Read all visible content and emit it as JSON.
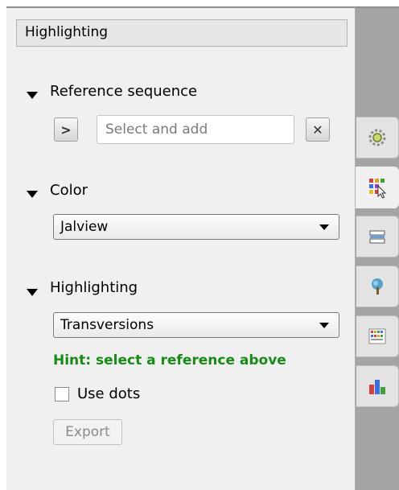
{
  "header": {
    "title": "Highlighting"
  },
  "reference": {
    "title": "Reference sequence",
    "placeholder": "Select and add",
    "expand_glyph": ">",
    "clear_glyph": "✕"
  },
  "color": {
    "title": "Color",
    "selected": "Jalview"
  },
  "highlighting": {
    "title": "Highlighting",
    "selected": "Transversions",
    "hint": "Hint: select a reference above",
    "use_dots_label": "Use dots",
    "use_dots_checked": false,
    "export_label": "Export"
  },
  "side_tabs": [
    {
      "icon": "gear-icon"
    },
    {
      "icon": "color-grid-cursor-icon",
      "active": true
    },
    {
      "icon": "alignment-rows-icon"
    },
    {
      "icon": "tree-icon"
    },
    {
      "icon": "sequence-grid-icon"
    },
    {
      "icon": "bar-chart-icon"
    }
  ],
  "colors": {
    "hint_green": "#178a17",
    "panel_bg": "#f0f0f0",
    "sidebar_bg": "#a4a4a4"
  }
}
